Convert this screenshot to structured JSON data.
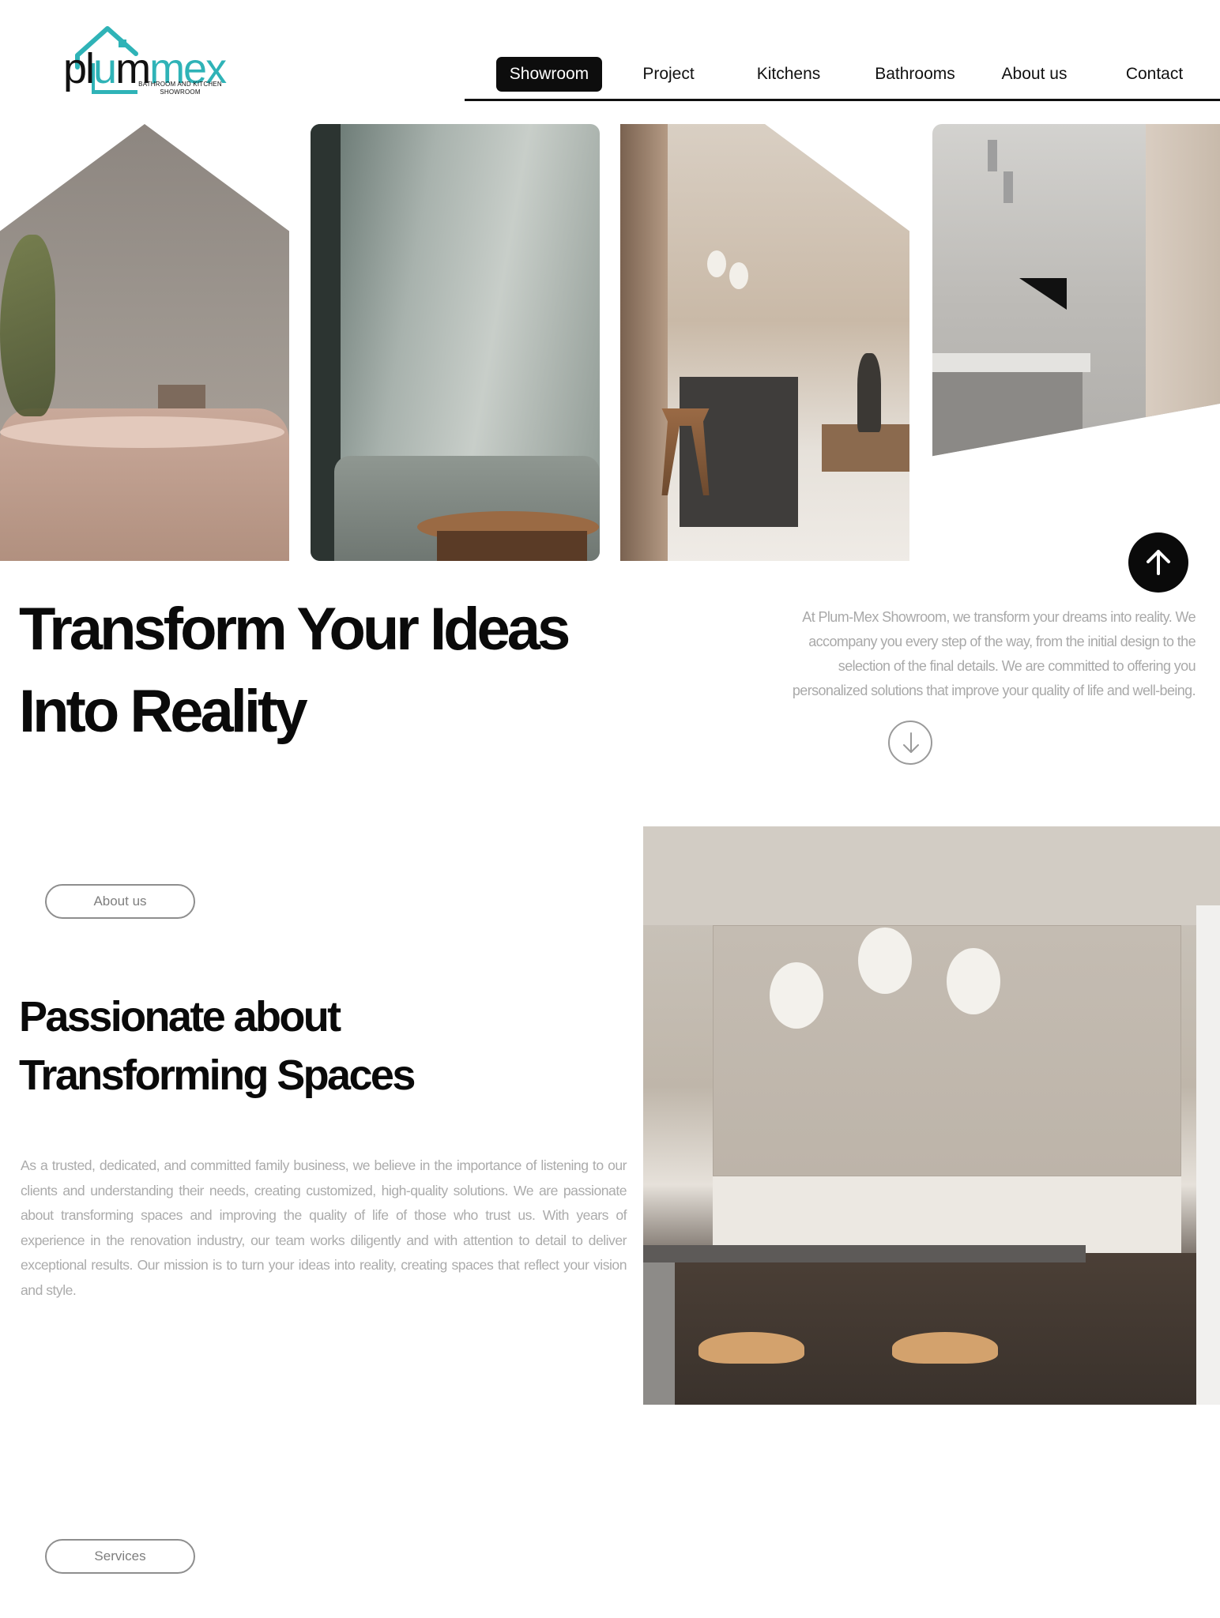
{
  "brand": {
    "name_part1": "pl",
    "name_part2": "u",
    "name_part3": "m",
    "name_part4": "mex",
    "tagline_line1": "BATHROOM AND KITCHEN",
    "tagline_line2": "SHOWROOM",
    "accent_color": "#2fb3b7"
  },
  "nav": {
    "items": [
      {
        "label": "Showroom",
        "active": true
      },
      {
        "label": "Project",
        "active": false
      },
      {
        "label": "Kitchens",
        "active": false
      },
      {
        "label": "Bathrooms",
        "active": false
      },
      {
        "label": "About us",
        "active": false
      },
      {
        "label": "Contact",
        "active": false
      }
    ]
  },
  "hero": {
    "title_line1": "Transform Your Ideas",
    "title_line2": "Into Reality",
    "description": "At Plum-Mex Showroom, we transform your dreams into reality. We accompany you every step of the way, from the initial design to the selection of the final details. We are committed to offering you personalized solutions that improve your quality of life and well-being.",
    "up_icon": "arrow-up-icon",
    "down_icon": "arrow-down-icon"
  },
  "about": {
    "pill_label": "About us",
    "title_line1": "Passionate about",
    "title_line2": "Transforming Spaces",
    "text": "As a trusted, dedicated, and committed family business, we believe in the importance of listening to our clients and understanding their needs, creating customized, high-quality solutions. We are passionate about transforming spaces and improving the quality of life of those who trust us. With years of experience in the renovation industry, our team works diligently and with attention to detail to deliver exceptional results. Our mission is to turn your ideas into reality, creating spaces that reflect your vision and style."
  },
  "services": {
    "pill_label": "Services"
  }
}
